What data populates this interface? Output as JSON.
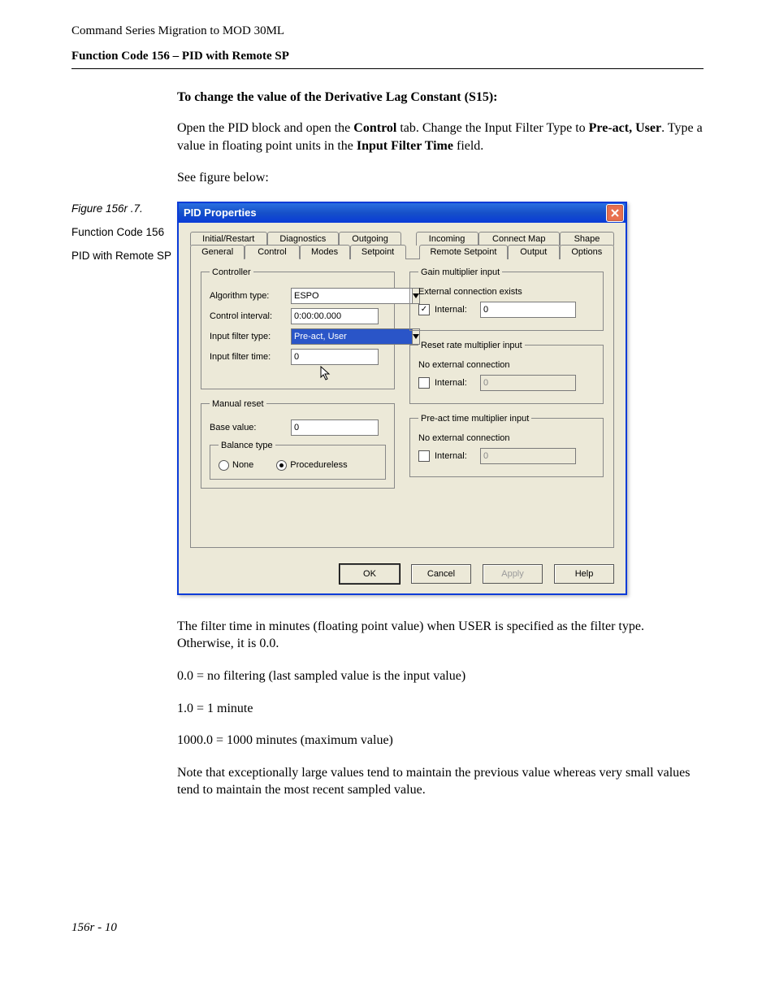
{
  "header": {
    "line1": "Command Series Migration to MOD 30ML",
    "line2": "Function Code 156 – PID with Remote SP"
  },
  "intro": {
    "heading": "To change the value of the Derivative Lag Constant (S15):",
    "p1a": "Open the PID block and open the ",
    "p1b": "Control",
    "p1c": " tab. Change the Input Filter Type to ",
    "p1d": "Pre-act, User",
    "p1e": ". Type a value in floating point units in the ",
    "p1f": "Input Filter Time",
    "p1g": " field.",
    "p2": "See figure below:"
  },
  "figure_side": {
    "caption": "Figure 156r .7.",
    "sub1": "Function Code 156",
    "sub2": "PID with Remote SP"
  },
  "dialog": {
    "title": "PID Properties",
    "tabs_row1": [
      "Initial/Restart",
      "Diagnostics",
      "Outgoing",
      "Incoming",
      "Connect Map",
      "Shape"
    ],
    "tabs_row2": [
      "General",
      "Control",
      "Modes",
      "Setpoint",
      "Remote Setpoint",
      "Output",
      "Options"
    ],
    "active_tab": "Control",
    "controller": {
      "legend": "Controller",
      "algorithm_label": "Algorithm type:",
      "algorithm_value": "ESPO",
      "interval_label": "Control interval:",
      "interval_value": "0:00:00.000",
      "filter_type_label": "Input filter type:",
      "filter_type_value": "Pre-act, User",
      "filter_time_label": "Input filter time:",
      "filter_time_value": "0"
    },
    "manual_reset": {
      "legend": "Manual reset",
      "base_label": "Base value:",
      "base_value": "0",
      "balance_legend": "Balance type",
      "radio_none": "None",
      "radio_proc": "Procedureless"
    },
    "gain": {
      "legend": "Gain multiplier input",
      "note": "External connection exists",
      "internal_label": "Internal:",
      "internal_checked": true,
      "internal_value": "0"
    },
    "reset": {
      "legend": "Reset rate multiplier input",
      "note": "No external connection",
      "internal_label": "Internal:",
      "internal_checked": false,
      "internal_value": "0"
    },
    "preact": {
      "legend": "Pre-act time multiplier input",
      "note": "No external connection",
      "internal_label": "Internal:",
      "internal_checked": false,
      "internal_value": "0"
    },
    "buttons": {
      "ok": "OK",
      "cancel": "Cancel",
      "apply": "Apply",
      "help": "Help"
    }
  },
  "notes": {
    "p1": "The filter time in minutes (floating point value) when USER is specified as the filter type. Otherwise, it is 0.0.",
    "p2": "0.0 = no filtering (last sampled value is the input value)",
    "p3": "1.0 = 1 minute",
    "p4": "1000.0 = 1000 minutes (maximum value)",
    "p5": "Note that exceptionally large values tend to maintain the previous value whereas very small values tend to maintain the most recent sampled value."
  },
  "footer": "156r - 10"
}
